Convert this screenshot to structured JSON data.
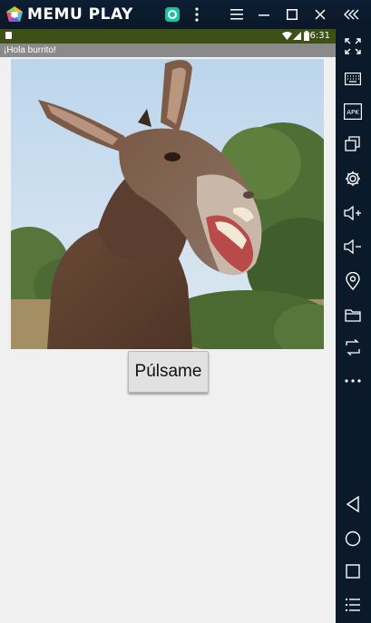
{
  "emulator": {
    "brand": "MEMU PLAY",
    "toolbar": [
      "expand-arrows-icon",
      "keyboard-icon",
      "apk-icon",
      "multi-window-icon",
      "settings-gear-icon",
      "volume-up-icon",
      "volume-down-icon",
      "location-pin-icon",
      "folder-icon",
      "rotate-icon",
      "more-dots-icon"
    ],
    "nav": [
      "back-triangle-icon",
      "home-circle-icon",
      "recents-square-icon",
      "menu-lines-icon"
    ],
    "apk_label": "APK"
  },
  "status_bar": {
    "time": "6:31"
  },
  "app": {
    "title": "¡Hola burrito!",
    "button_label": "Púlsame"
  },
  "colors": {
    "status_bar": "#3f4f18",
    "action_bar": "#8a8a8a",
    "screen_bg": "#f0f0f0",
    "emulator_frame": "#0b1a2a"
  }
}
